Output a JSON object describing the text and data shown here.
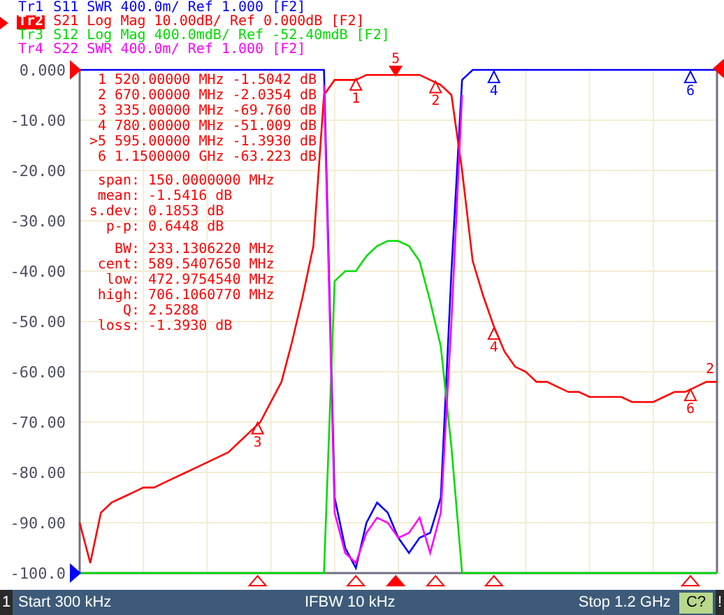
{
  "traces": [
    {
      "param": "S11",
      "format": "SWR 400.0m/ Ref 1.000 [F2]",
      "selected": false
    },
    {
      "param": "S21",
      "format": "Log Mag 10.00dB/ Ref 0.000dB [F2]",
      "selected": true
    },
    {
      "param": "S12",
      "format": "Log Mag 400.0mdB/ Ref -52.40mdB [F2]",
      "selected": false
    },
    {
      "param": "S22",
      "format": "SWR 400.0m/ Ref 1.000 [F2]",
      "selected": false
    }
  ],
  "marker_table": [
    {
      "label": "1",
      "frequency": "520.00000 MHz",
      "value": "-1.5042 dB"
    },
    {
      "label": "2",
      "frequency": "670.00000 MHz",
      "value": "-2.0354 dB"
    },
    {
      "label": "3",
      "frequency": "335.00000 MHz",
      "value": "-69.760 dB"
    },
    {
      "label": "4",
      "frequency": "780.00000 MHz",
      "value": "-51.009 dB"
    },
    {
      "label": ">5",
      "frequency": "595.00000 MHz",
      "value": "-1.3930 dB"
    },
    {
      "label": "6",
      "frequency": "1.1500000 GHz",
      "value": "-63.223 dB"
    }
  ],
  "statistics": [
    {
      "label": "span:",
      "value": "150.0000000 MHz"
    },
    {
      "label": "mean:",
      "value": "-1.5416 dB"
    },
    {
      "label": "s.dev:",
      "value": "0.1853 dB"
    },
    {
      "label": "p-p:",
      "value": "0.6448 dB"
    }
  ],
  "bandwidth": [
    {
      "label": "BW:",
      "value": "233.1306220 MHz"
    },
    {
      "label": "cent:",
      "value": "589.5407650 MHz"
    },
    {
      "label": "low:",
      "value": "472.9754540 MHz"
    },
    {
      "label": "high:",
      "value": "706.1060770 MHz"
    },
    {
      "label": "Q:",
      "value": "2.5288"
    },
    {
      "label": "loss:",
      "value": "-1.3930 dB"
    }
  ],
  "chart_data": {
    "type": "line",
    "ylim": [
      -100,
      0
    ],
    "yticks": [
      {
        "value": 0,
        "label": "0.000"
      },
      {
        "value": -10,
        "label": "-10.00"
      },
      {
        "value": -20,
        "label": "-20.00"
      },
      {
        "value": -30,
        "label": "-30.00"
      },
      {
        "value": -40,
        "label": "-40.00"
      },
      {
        "value": -50,
        "label": "-50.00"
      },
      {
        "value": -60,
        "label": "-60.00"
      },
      {
        "value": -70,
        "label": "-70.00"
      },
      {
        "value": -80,
        "label": "-80.00"
      },
      {
        "value": -90,
        "label": "-90.00"
      },
      {
        "value": -100,
        "label": "-100.0"
      }
    ],
    "categories": [
      null,
      null,
      null,
      null,
      null,
      null,
      null,
      null,
      null,
      null,
      null,
      null,
      null,
      null,
      null,
      null,
      null,
      null,
      null,
      null,
      null,
      null,
      null,
      null,
      null,
      null,
      null,
      null,
      null,
      null,
      null,
      null,
      null,
      null,
      null,
      null,
      null,
      null,
      null,
      null,
      null,
      null,
      null,
      null,
      null,
      null,
      null,
      null,
      null,
      null,
      null,
      null,
      null,
      null,
      null,
      null,
      null,
      null,
      null,
      null,
      null
    ],
    "series": [
      {
        "name": "Tr1",
        "color": "#0000ff",
        "values": [
          0,
          0,
          0,
          0,
          0,
          0,
          0,
          0,
          0,
          0,
          0,
          0,
          0,
          0,
          0,
          0,
          0,
          0,
          0,
          0,
          0,
          0,
          0,
          0,
          -85,
          -95,
          -99,
          -90,
          -86,
          -88,
          -93,
          -96,
          -93,
          -92,
          -85,
          -40,
          -2,
          0,
          0,
          0,
          0,
          0,
          0,
          0,
          0,
          0,
          0,
          0,
          0,
          0,
          0,
          0,
          0,
          0,
          0,
          0,
          0,
          0,
          0,
          0,
          0
        ]
      },
      {
        "name": "Tr2",
        "color": "#ff0000",
        "values": [
          -90,
          -98,
          -88,
          -86,
          -85,
          -84,
          -83,
          -83,
          -82,
          -81,
          -80,
          -79,
          -78,
          -77,
          -76,
          -74,
          -72,
          -70,
          -66,
          -62,
          -54,
          -45,
          -35,
          -5,
          -2,
          -2,
          -2,
          -1,
          -1,
          -1,
          -1,
          -1,
          -1,
          -2,
          -3,
          -5,
          -20,
          -38,
          -45,
          -51,
          -56,
          -59,
          -60,
          -62,
          -62,
          -63,
          -64,
          -64,
          -65,
          -65,
          -65,
          -65,
          -66,
          -66,
          -66,
          -65,
          -64,
          -64,
          -63,
          -62,
          -62
        ]
      },
      {
        "name": "Tr3",
        "color": "#00dd00",
        "values": [
          -100,
          -100,
          -100,
          -100,
          -100,
          -100,
          -100,
          -100,
          -100,
          -100,
          -100,
          -100,
          -100,
          -100,
          -100,
          -100,
          -100,
          -100,
          -100,
          -100,
          -100,
          -100,
          -100,
          -100,
          -42,
          -40,
          -40,
          -37,
          -35,
          -34,
          -34,
          -35,
          -38,
          -46,
          -55,
          -75,
          -100,
          -100,
          -100,
          -100,
          -100,
          -100,
          -100,
          -100,
          -100,
          -100,
          -100,
          -100,
          -100,
          -100,
          -100,
          -100,
          -100,
          -100,
          -100,
          -100,
          -100,
          -100,
          -100,
          -100,
          -100
        ]
      },
      {
        "name": "Tr4",
        "color": "#ff00ff",
        "values": [
          null,
          null,
          null,
          null,
          null,
          null,
          null,
          null,
          null,
          null,
          null,
          null,
          null,
          null,
          null,
          null,
          null,
          null,
          null,
          null,
          null,
          null,
          null,
          -3,
          -88,
          -96,
          -98,
          -92,
          -89,
          -90,
          -93,
          -92,
          -89,
          -96,
          -88,
          -50,
          -5,
          null,
          null,
          null,
          null,
          null,
          null,
          null,
          null,
          null,
          null,
          null,
          null,
          null,
          null,
          null,
          null,
          null,
          null,
          null,
          null,
          null,
          null,
          null,
          null
        ]
      }
    ],
    "grid": true,
    "annotations": [
      {
        "y": -1.5,
        "text": "1"
      },
      {
        "y": -2.0,
        "text": "2"
      },
      {
        "y": -69.8,
        "text": "3"
      },
      {
        "y": -51.0,
        "text": "4"
      },
      {
        "y": -1.4,
        "text": "5"
      },
      {
        "y": -63.2,
        "text": "6"
      },
      {
        "y": 0,
        "text": "4"
      },
      {
        "y": 0,
        "text": "6"
      },
      {
        "y": -62,
        "text": "2"
      }
    ]
  },
  "markers": [
    {
      "kind": "marker",
      "color": "#ff0000",
      "selected": false
    },
    {
      "kind": "marker",
      "color": "#ff0000",
      "selected": false
    },
    {
      "kind": "marker",
      "color": "#ff0000",
      "selected": false
    },
    {
      "kind": "marker",
      "color": "#ff0000",
      "selected": false
    },
    {
      "kind": "marker",
      "color": "#ff0000",
      "selected": true
    },
    {
      "kind": "marker",
      "color": "#ff0000",
      "selected": false
    },
    {
      "kind": "marker",
      "color": "#0000ff",
      "selected": false
    },
    {
      "kind": "marker",
      "color": "#0000ff",
      "selected": false
    },
    {
      "kind": "end_label",
      "color": "#ff0000"
    }
  ],
  "status_bar": {
    "channel": "1",
    "start": "Start 300 kHz",
    "ifbw": "IFBW 10 kHz",
    "stop": "Stop 1.2 GHz",
    "calibration": "C?",
    "alert": "!"
  }
}
